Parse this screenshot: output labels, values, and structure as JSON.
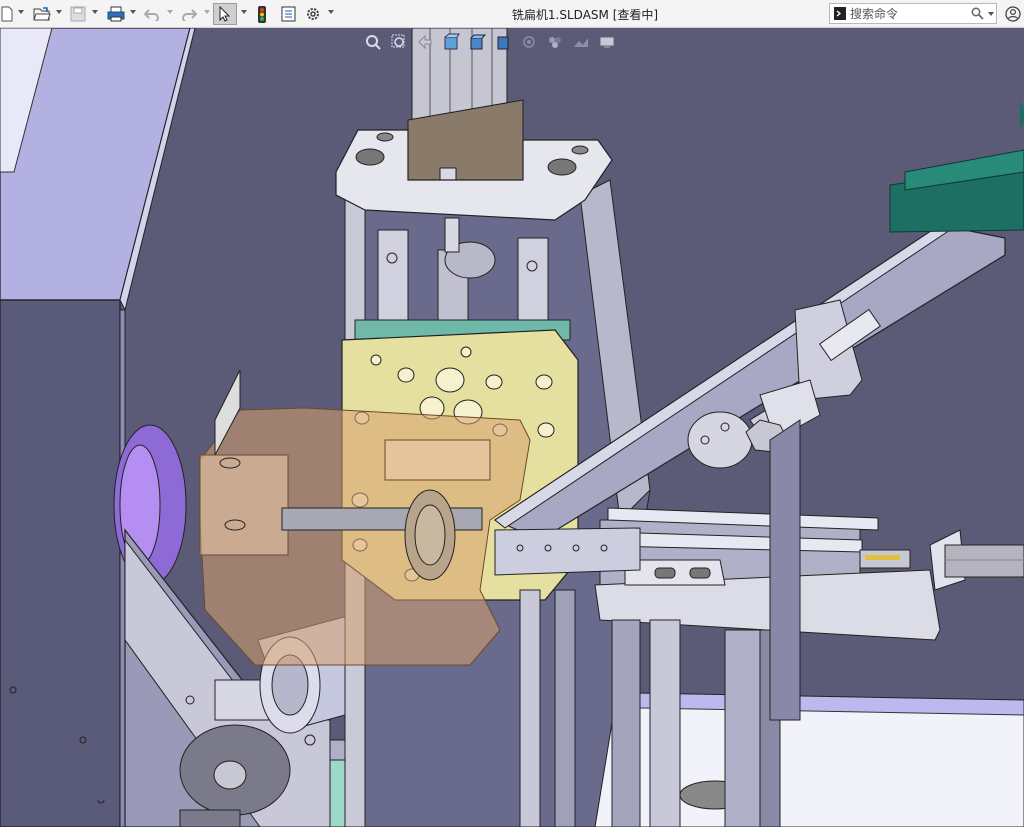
{
  "window": {
    "title": "铣扁机1.SLDASM [查看中]"
  },
  "toolbar": {
    "items": [
      {
        "name": "new-document-button",
        "icon": "page-icon"
      },
      {
        "name": "open-button",
        "icon": "folder-open-icon"
      },
      {
        "name": "save-button",
        "icon": "floppy-icon"
      },
      {
        "name": "print-button",
        "icon": "printer-icon"
      },
      {
        "name": "undo-button",
        "icon": "undo-icon"
      },
      {
        "name": "redo-button",
        "icon": "redo-icon"
      },
      {
        "name": "select-button",
        "icon": "cursor-arrow-icon"
      },
      {
        "name": "rebuild-button",
        "icon": "traffic-light-icon"
      },
      {
        "name": "file-properties-button",
        "icon": "properties-icon"
      },
      {
        "name": "options-button",
        "icon": "gear-icon"
      }
    ]
  },
  "search": {
    "placeholder": "搜索命令"
  },
  "heads_up_toolbar": {
    "icons": [
      "zoom-to-fit-icon",
      "zoom-area-icon",
      "previous-view-icon",
      "section-view-icon",
      "view-orientation-icon",
      "display-style-icon",
      "hide-show-icon",
      "edit-appearance-icon",
      "apply-scene-icon",
      "view-settings-icon"
    ]
  },
  "colors": {
    "background": "#5b5b78",
    "part_gray": "#c7c7d2",
    "part_lavender": "#a7a5d9",
    "part_yellow": "#e6e0a0",
    "part_orange_transparent": "#d7a06e",
    "part_teal": "#1d6f63"
  }
}
